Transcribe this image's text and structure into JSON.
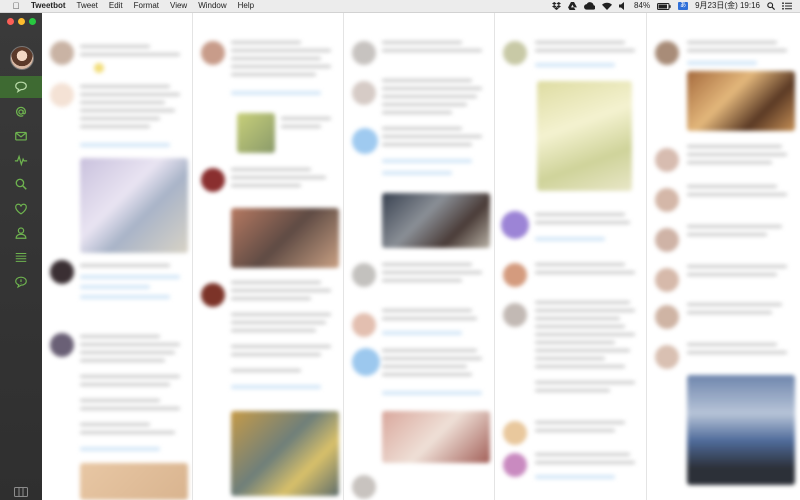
{
  "menubar": {
    "apple_icon": "apple-icon",
    "app_name": "Tweetbot",
    "menus": [
      "Tweet",
      "Edit",
      "Format",
      "View",
      "Window",
      "Help"
    ],
    "battery_percent": "84%",
    "ime_label": "あ",
    "datetime": "9月23日(金) 19:16"
  },
  "sidebar": {
    "items": [
      {
        "icon": "speech-bubble-icon",
        "name": "timeline",
        "active": true
      },
      {
        "icon": "at-sign-icon",
        "name": "mentions"
      },
      {
        "icon": "envelope-icon",
        "name": "messages"
      },
      {
        "icon": "activity-icon",
        "name": "activity"
      },
      {
        "icon": "search-icon",
        "name": "search"
      },
      {
        "icon": "heart-icon",
        "name": "favorites"
      },
      {
        "icon": "person-icon",
        "name": "profile"
      },
      {
        "icon": "list-icon",
        "name": "lists"
      },
      {
        "icon": "mute-icon",
        "name": "mutes"
      }
    ],
    "active_color": "#3e6a32"
  },
  "colors": {
    "sidebar_bg": "#333333",
    "close": "#fc5f57",
    "minimize": "#fdbc2e",
    "zoom": "#28c840"
  }
}
